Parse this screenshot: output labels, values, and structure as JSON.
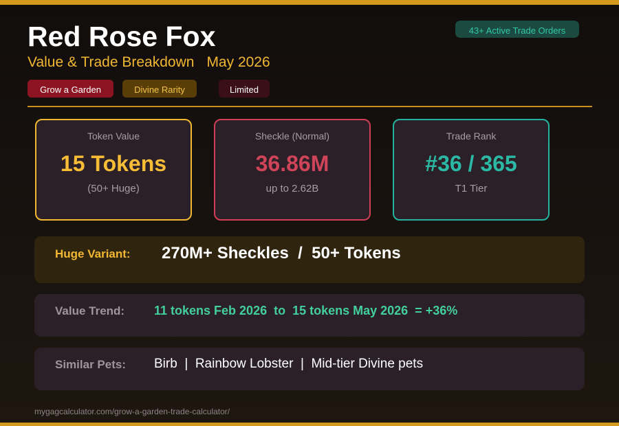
{
  "header": {
    "title": "Red Rose Fox",
    "subtitle": "Value & Trade Breakdown",
    "date": "May 2026",
    "orders_badge": "43+ Active Trade Orders"
  },
  "tags": {
    "game": "Grow a Garden",
    "rarity": "Divine Rarity",
    "status": "Limited"
  },
  "cards": {
    "token": {
      "label": "Token Value",
      "value": "15 Tokens",
      "sub": "(50+ Huge)"
    },
    "sheckle": {
      "label": "Sheckle (Normal)",
      "value": "36.86M",
      "sub": "up to 2.62B"
    },
    "rank": {
      "label": "Trade Rank",
      "value": "#36 / 365",
      "sub": "T1 Tier"
    }
  },
  "panels": {
    "huge": {
      "label": "Huge Variant:",
      "value": "270M+ Sheckles  /  50+ Tokens"
    },
    "trend": {
      "label": "Value Trend:",
      "value": "11 tokens Feb 2026  to  15 tokens May 2026  = +36%"
    },
    "similar": {
      "label": "Similar Pets:",
      "value": "Birb  |  Rainbow Lobster  |  Mid-tier Divine pets"
    }
  },
  "footer": {
    "url": "mygagcalculator.com/grow-a-garden-trade-calculator/"
  },
  "colors": {
    "accent_gold": "#f1b830",
    "accent_red": "#cf3e55",
    "accent_teal": "#23b3a0",
    "trend_green": "#43cf9c",
    "background": "#110d0c"
  }
}
